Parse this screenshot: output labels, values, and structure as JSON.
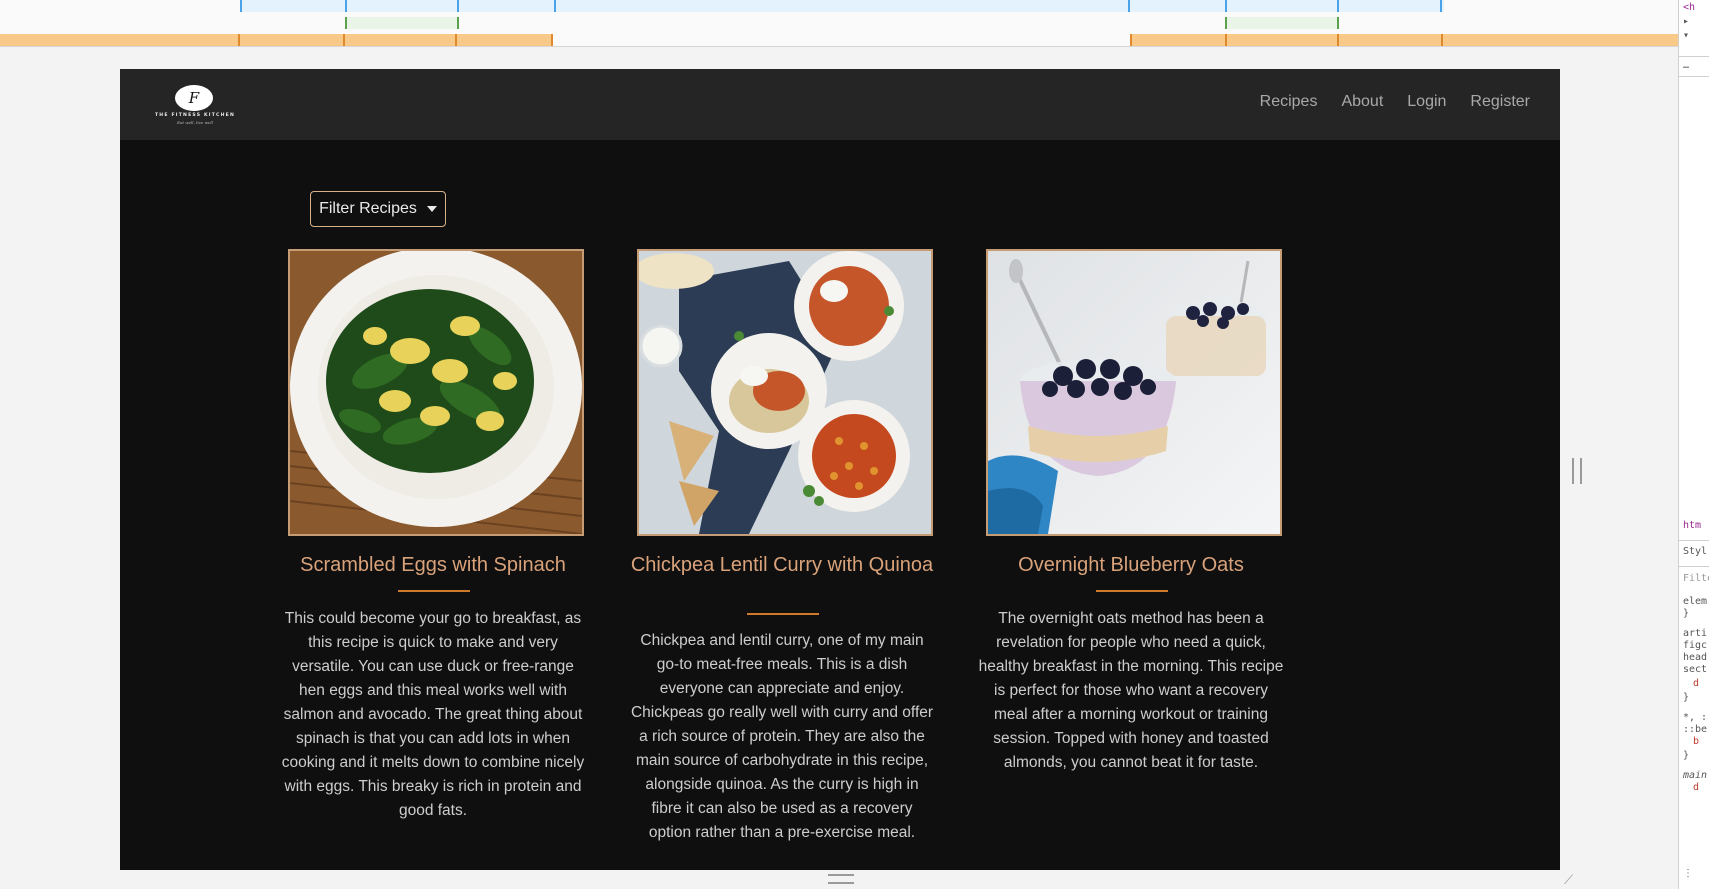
{
  "nav": {
    "logo_initial": "F",
    "logo_brand": "THE FITNESS KITCHEN",
    "logo_tagline": "Eat well, live well",
    "links": [
      "Recipes",
      "About",
      "Login",
      "Register"
    ]
  },
  "filter": {
    "label": "Filter Recipes"
  },
  "recipes": [
    {
      "title": "Scrambled Eggs with Spinach",
      "description": "This could become your go to breakfast, as this recipe is quick to make and very versatile. You can use duck or free-range hen eggs and this meal works well with salmon and avocado. The great thing about spinach is that you can add lots in when cooking and it melts down to combine nicely with eggs. This breaky is rich in protein and good fats."
    },
    {
      "title": "Chickpea Lentil Curry with Quinoa",
      "description": "Chickpea and lentil curry, one of my main go-to meat-free meals. This is a dish everyone can appreciate and enjoy. Chickpeas go really well with curry and offer a rich source of protein. They are also the main source of carbohydrate in this recipe, alongside quinoa. As the curry is high in fibre it can also be used as a recovery option rather than a pre-exercise meal."
    },
    {
      "title": "Overnight Blueberry Oats",
      "description": "The overnight oats method has been a revelation for people who need a quick, healthy breakfast in the morning. This recipe is perfect for those who want a recovery meal after a morning workout or training session. Topped with honey and toasted almonds, you cannot beat it for taste."
    }
  ],
  "devtools": {
    "rows": [
      "<h",
      "▸",
      "▾",
      "…",
      "htm",
      "Styl",
      "Filte",
      "elem",
      "}",
      "arti",
      "figc",
      "head",
      "sect",
      "d",
      "}",
      "*, :",
      "::be",
      "b",
      "}",
      "main",
      "d",
      "⋮"
    ]
  },
  "colors": {
    "page_bg": "#0f0f0f",
    "navbar_bg": "#252525",
    "title_accent": "#d9a27a",
    "rule_accent": "#cf7a2a",
    "image_border": "#c69c75"
  }
}
